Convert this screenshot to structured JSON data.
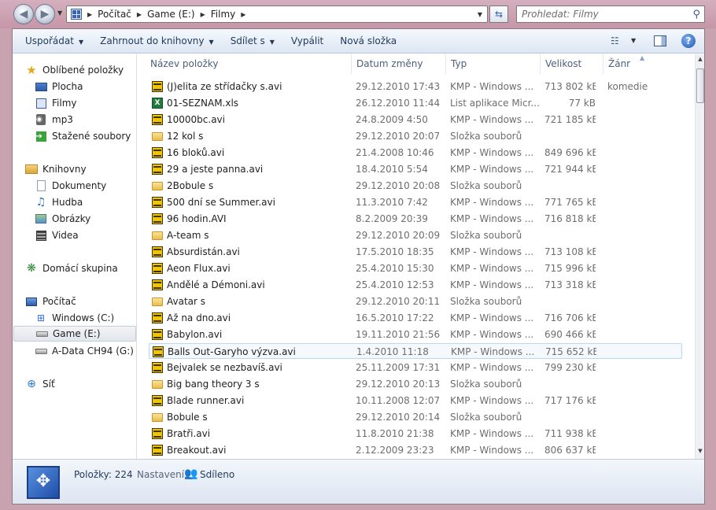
{
  "address": {
    "breadcrumbs": [
      "Počítač",
      "Game (E:)",
      "Filmy"
    ],
    "search_placeholder": "Prohledat: Filmy"
  },
  "toolbar": {
    "organize": "Uspořádat",
    "include_library": "Zahrnout do knihovny",
    "share": "Sdílet s",
    "burn": "Vypálit",
    "new_folder": "Nová složka"
  },
  "nav": {
    "favorites": "Oblíbené položky",
    "desktop": "Plocha",
    "films": "Filmy",
    "mp3": "mp3",
    "downloads": "Stažené soubory",
    "libraries": "Knihovny",
    "documents": "Dokumenty",
    "music": "Hudba",
    "pictures": "Obrázky",
    "videos": "Videa",
    "homegroup": "Domácí skupina",
    "computer": "Počítač",
    "drive_c": "Windows (C:)",
    "drive_e": "Game (E:)",
    "drive_g": "A-Data CH94 (G:)",
    "network": "Síť"
  },
  "columns": {
    "name": "Název položky",
    "date": "Datum změny",
    "type": "Typ",
    "size": "Velikost",
    "genre": "Žánr"
  },
  "files": [
    {
      "name": "(J)elita ze střídačky s.avi",
      "date": "29.12.2010 17:43",
      "type": "KMP - Windows ...",
      "size": "713 802 kB",
      "genre": "komedie",
      "icon": "kmp"
    },
    {
      "name": "01-SEZNAM.xls",
      "date": "26.12.2010 11:44",
      "type": "List aplikace Micr...",
      "size": "77 kB",
      "genre": "",
      "icon": "xls"
    },
    {
      "name": "10000bc.avi",
      "date": "24.8.2009 4:50",
      "type": "KMP - Windows ...",
      "size": "721 185 kB",
      "genre": "",
      "icon": "kmp"
    },
    {
      "name": "12 kol s",
      "date": "29.12.2010 20:07",
      "type": "Složka souborů",
      "size": "",
      "genre": "",
      "icon": "folder"
    },
    {
      "name": "16 bloků.avi",
      "date": "21.4.2008 10:46",
      "type": "KMP - Windows ...",
      "size": "849 696 kB",
      "genre": "",
      "icon": "kmp"
    },
    {
      "name": "29 a jeste panna.avi",
      "date": "18.4.2010 5:54",
      "type": "KMP - Windows ...",
      "size": "721 944 kB",
      "genre": "",
      "icon": "kmp"
    },
    {
      "name": "2Bobule s",
      "date": "29.12.2010 20:08",
      "type": "Složka souborů",
      "size": "",
      "genre": "",
      "icon": "folder"
    },
    {
      "name": "500 dní se Summer.avi",
      "date": "11.3.2010 7:42",
      "type": "KMP - Windows ...",
      "size": "771 765 kB",
      "genre": "",
      "icon": "kmp"
    },
    {
      "name": "96 hodin.AVI",
      "date": "8.2.2009 20:39",
      "type": "KMP - Windows ...",
      "size": "716 818 kB",
      "genre": "",
      "icon": "kmp"
    },
    {
      "name": "A-team s",
      "date": "29.12.2010 20:09",
      "type": "Složka souborů",
      "size": "",
      "genre": "",
      "icon": "folder"
    },
    {
      "name": "Absurdistán.avi",
      "date": "17.5.2010 18:35",
      "type": "KMP - Windows ...",
      "size": "713 108 kB",
      "genre": "",
      "icon": "kmp"
    },
    {
      "name": "Aeon Flux.avi",
      "date": "25.4.2010 15:30",
      "type": "KMP - Windows ...",
      "size": "715 996 kB",
      "genre": "",
      "icon": "kmp"
    },
    {
      "name": "Andělé a Démoni.avi",
      "date": "25.4.2010 12:53",
      "type": "KMP - Windows ...",
      "size": "713 318 kB",
      "genre": "",
      "icon": "kmp"
    },
    {
      "name": "Avatar s",
      "date": "29.12.2010 20:11",
      "type": "Složka souborů",
      "size": "",
      "genre": "",
      "icon": "folder"
    },
    {
      "name": "Až na dno.avi",
      "date": "16.5.2010 17:22",
      "type": "KMP - Windows ...",
      "size": "716 706 kB",
      "genre": "",
      "icon": "kmp"
    },
    {
      "name": "Babylon.avi",
      "date": "19.11.2010 21:56",
      "type": "KMP - Windows ...",
      "size": "690 466 kB",
      "genre": "",
      "icon": "kmp"
    },
    {
      "name": "Balls Out-Garyho výzva.avi",
      "date": "1.4.2010 11:18",
      "type": "KMP - Windows ...",
      "size": "715 652 kB",
      "genre": "",
      "icon": "kmp"
    },
    {
      "name": "Bejvalek se nezbavíš.avi",
      "date": "25.11.2009 17:31",
      "type": "KMP - Windows ...",
      "size": "799 230 kB",
      "genre": "",
      "icon": "kmp"
    },
    {
      "name": "Big bang theory 3 s",
      "date": "29.12.2010 20:13",
      "type": "Složka souborů",
      "size": "",
      "genre": "",
      "icon": "folder"
    },
    {
      "name": "Blade runner.avi",
      "date": "10.11.2008 12:07",
      "type": "KMP - Windows ...",
      "size": "717 176 kB",
      "genre": "",
      "icon": "kmp"
    },
    {
      "name": "Bobule s",
      "date": "29.12.2010 20:14",
      "type": "Složka souborů",
      "size": "",
      "genre": "",
      "icon": "folder"
    },
    {
      "name": "Bratři.avi",
      "date": "11.8.2010 21:38",
      "type": "KMP - Windows ...",
      "size": "711 938 kB",
      "genre": "",
      "icon": "kmp"
    },
    {
      "name": "Breakout.avi",
      "date": "2.12.2009 23:23",
      "type": "KMP - Windows ...",
      "size": "806 637 kB",
      "genre": "",
      "icon": "kmp"
    }
  ],
  "details": {
    "items_count": "Položky: 224",
    "share_label": "Nastavení:",
    "share_value": "Sdíleno"
  }
}
